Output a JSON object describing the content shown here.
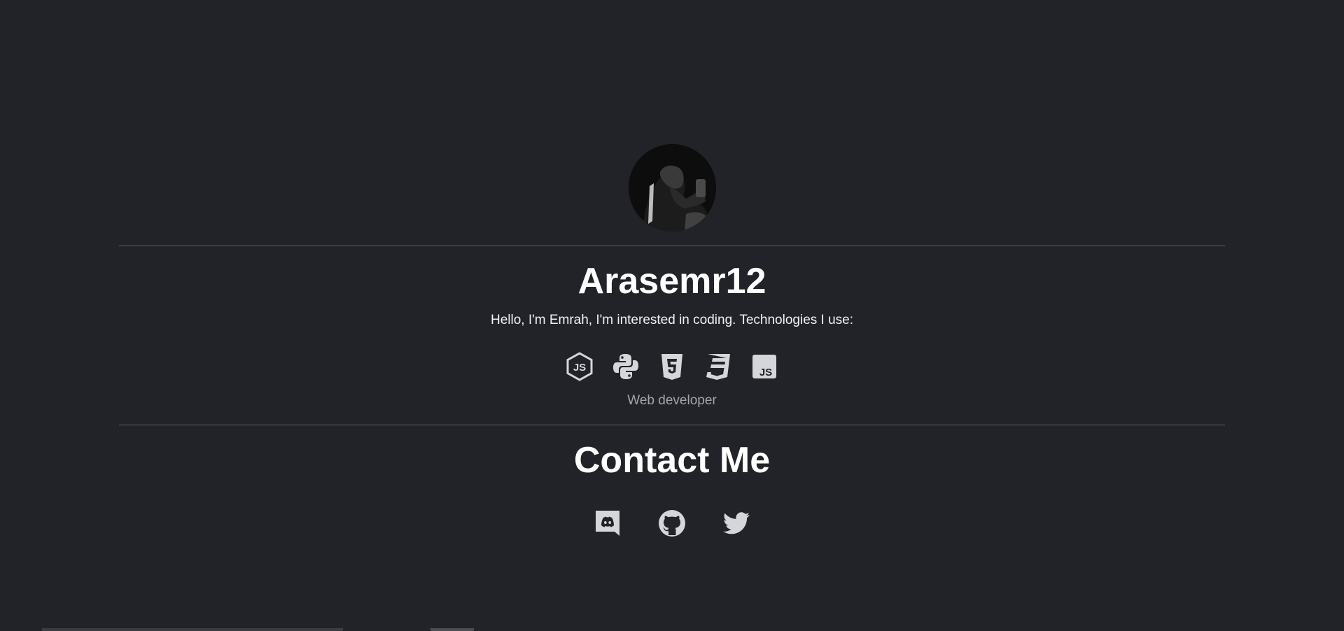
{
  "profile": {
    "avatar_alt": "profile photo",
    "username": "Arasemr12",
    "intro": "Hello, I'm Emrah, I'm interested in coding. Technologies I use:",
    "role": "Web developer"
  },
  "technologies": [
    {
      "name": "nodejs",
      "icon": "nodejs-icon"
    },
    {
      "name": "python",
      "icon": "python-icon"
    },
    {
      "name": "html5",
      "icon": "html5-icon"
    },
    {
      "name": "css3",
      "icon": "css3-icon"
    },
    {
      "name": "javascript",
      "icon": "javascript-icon"
    }
  ],
  "contact": {
    "title": "Contact Me",
    "links": [
      {
        "name": "discord",
        "icon": "discord-icon"
      },
      {
        "name": "github",
        "icon": "github-icon"
      },
      {
        "name": "twitter",
        "icon": "twitter-icon"
      }
    ]
  },
  "colors": {
    "background": "#212328",
    "text": "#ffffff",
    "muted_text": "#a3a5a8",
    "icon": "#d4d6d9",
    "divider": "#5f6166"
  }
}
